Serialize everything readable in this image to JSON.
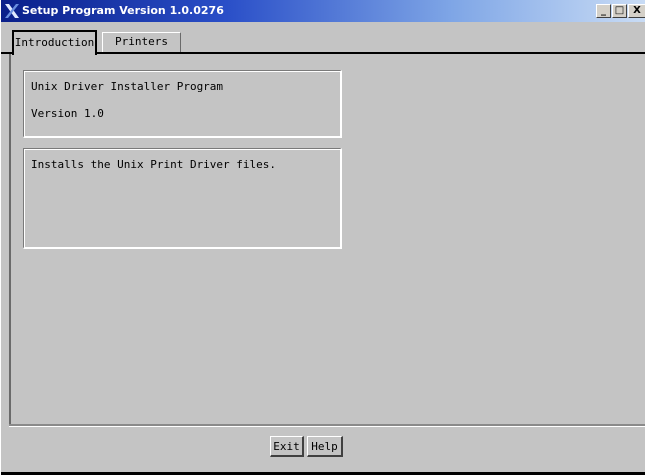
{
  "window": {
    "title": "Setup Program Version 1.0.0276",
    "controls": {
      "minimize": "_",
      "maximize": "□",
      "close": "X"
    }
  },
  "tabs": [
    {
      "label": "Introduction",
      "selected": true
    },
    {
      "label": "Printers",
      "selected": false
    }
  ],
  "info": {
    "program_name": "Unix Driver Installer Program",
    "version": "Version 1.0"
  },
  "description": "Installs the Unix Print Driver files.",
  "buttons": {
    "exit": "Exit",
    "help": "Help"
  },
  "colors": {
    "title_gradient_start": "#0a1f8a",
    "title_gradient_end": "#c9dcf5",
    "background": "#c4c4c4"
  },
  "icons": {
    "app": "x-window-icon"
  }
}
